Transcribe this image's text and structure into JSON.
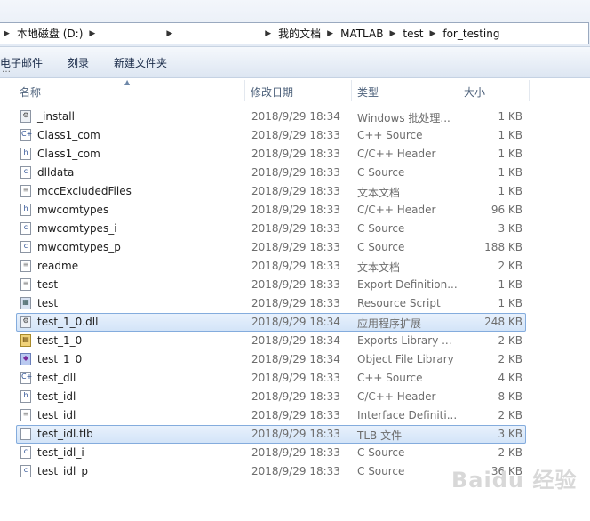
{
  "address": {
    "crumbs": [
      "本地磁盘 (D:)",
      "我的文档",
      "MATLAB",
      "test",
      "for_testing"
    ]
  },
  "toolbar": {
    "buttons": [
      "电子邮件",
      "刻录",
      "新建文件夹"
    ]
  },
  "columns": {
    "name": "名称",
    "date": "修改日期",
    "type": "类型",
    "size": "大小"
  },
  "files": [
    {
      "name": "_install",
      "date": "2018/9/29 18:34",
      "type": "Windows 批处理...",
      "size": "1 KB",
      "icon": "batch-file-icon"
    },
    {
      "name": "Class1_com",
      "date": "2018/9/29 18:33",
      "type": "C++ Source",
      "size": "1 KB",
      "icon": "cpp-source-icon"
    },
    {
      "name": "Class1_com",
      "date": "2018/9/29 18:33",
      "type": "C/C++ Header",
      "size": "1 KB",
      "icon": "header-file-icon"
    },
    {
      "name": "dlldata",
      "date": "2018/9/29 18:33",
      "type": "C Source",
      "size": "1 KB",
      "icon": "c-source-icon"
    },
    {
      "name": "mccExcludedFiles",
      "date": "2018/9/29 18:33",
      "type": "文本文档",
      "size": "1 KB",
      "icon": "text-document-icon"
    },
    {
      "name": "mwcomtypes",
      "date": "2018/9/29 18:33",
      "type": "C/C++ Header",
      "size": "96 KB",
      "icon": "header-file-icon"
    },
    {
      "name": "mwcomtypes_i",
      "date": "2018/9/29 18:33",
      "type": "C Source",
      "size": "3 KB",
      "icon": "c-source-icon"
    },
    {
      "name": "mwcomtypes_p",
      "date": "2018/9/29 18:33",
      "type": "C Source",
      "size": "188 KB",
      "icon": "c-source-icon"
    },
    {
      "name": "readme",
      "date": "2018/9/29 18:33",
      "type": "文本文档",
      "size": "2 KB",
      "icon": "text-document-icon"
    },
    {
      "name": "test",
      "date": "2018/9/29 18:33",
      "type": "Export Definition...",
      "size": "1 KB",
      "icon": "export-definition-icon"
    },
    {
      "name": "test",
      "date": "2018/9/29 18:33",
      "type": "Resource Script",
      "size": "1 KB",
      "icon": "resource-script-icon"
    },
    {
      "name": "test_1_0.dll",
      "date": "2018/9/29 18:34",
      "type": "应用程序扩展",
      "size": "248 KB",
      "icon": "dll-gear-icon",
      "selected": true
    },
    {
      "name": "test_1_0",
      "date": "2018/9/29 18:34",
      "type": "Exports Library ...",
      "size": "2 KB",
      "icon": "library-icon"
    },
    {
      "name": "test_1_0",
      "date": "2018/9/29 18:34",
      "type": "Object File Library",
      "size": "2 KB",
      "icon": "object-library-icon"
    },
    {
      "name": "test_dll",
      "date": "2018/9/29 18:33",
      "type": "C++ Source",
      "size": "4 KB",
      "icon": "cpp-source-icon"
    },
    {
      "name": "test_idl",
      "date": "2018/9/29 18:33",
      "type": "C/C++ Header",
      "size": "8 KB",
      "icon": "header-file-icon"
    },
    {
      "name": "test_idl",
      "date": "2018/9/29 18:33",
      "type": "Interface Definiti...",
      "size": "2 KB",
      "icon": "interface-definition-icon"
    },
    {
      "name": "test_idl.tlb",
      "date": "2018/9/29 18:33",
      "type": "TLB 文件",
      "size": "3 KB",
      "icon": "blank-file-icon",
      "selected": true
    },
    {
      "name": "test_idl_i",
      "date": "2018/9/29 18:33",
      "type": "C Source",
      "size": "2 KB",
      "icon": "c-source-icon"
    },
    {
      "name": "test_idl_p",
      "date": "2018/9/29 18:33",
      "type": "C Source",
      "size": "36 KB",
      "icon": "c-source-icon"
    }
  ],
  "watermark": "Baidu 经验"
}
